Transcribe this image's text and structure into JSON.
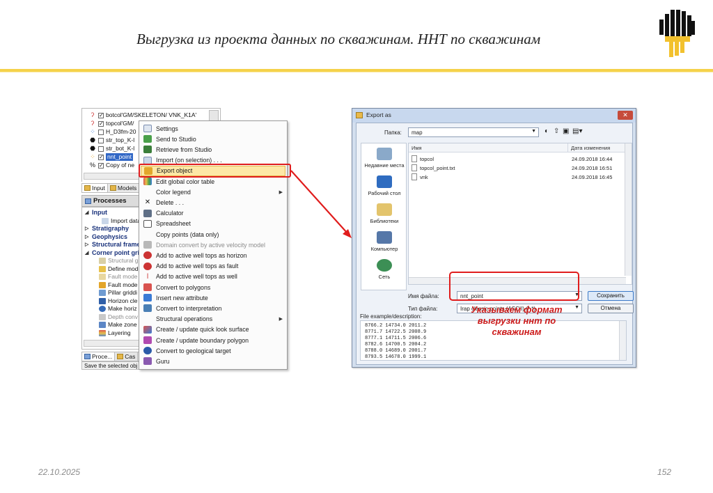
{
  "slide": {
    "title": "Выгрузка из проекта данных по скважинам. ННТ по скважинам",
    "date": "22.10.2025",
    "page": "152",
    "gold": "#f5d24a"
  },
  "tree": {
    "rows": [
      {
        "name": "botcol'GM/SKELETON/ VNK_K1A'"
      },
      {
        "name": "topcol'GM/"
      },
      {
        "name": "H_D3fm-20"
      },
      {
        "name": "str_top_K-l"
      },
      {
        "name": "str_bot_K-l"
      },
      {
        "name": "nnt_point"
      },
      {
        "name": "Copy of ne"
      }
    ],
    "tabs": [
      "Input",
      "Models"
    ]
  },
  "processes": {
    "header": "Processes",
    "items": [
      {
        "label": "Input",
        "type": "cat"
      },
      {
        "label": "Import data",
        "type": "item"
      },
      {
        "label": "Stratigraphy",
        "type": "cat"
      },
      {
        "label": "Geophysics",
        "type": "cat"
      },
      {
        "label": "Structural frame",
        "type": "cat"
      },
      {
        "label": "Corner point gri",
        "type": "cat"
      },
      {
        "label": "Structural g",
        "type": "dis"
      },
      {
        "label": "Define mod",
        "type": "item"
      },
      {
        "label": "Fault mode",
        "type": "dis"
      },
      {
        "label": "Fault mode",
        "type": "item"
      },
      {
        "label": "Pillar griddi",
        "type": "item"
      },
      {
        "label": "Horizon cle",
        "type": "item"
      },
      {
        "label": "Make horiz",
        "type": "item"
      },
      {
        "label": "Depth conv",
        "type": "dis"
      },
      {
        "label": "Make zone",
        "type": "item"
      },
      {
        "label": "Layering",
        "type": "item"
      }
    ],
    "bottom_tabs": [
      "Proce...",
      "Cas"
    ],
    "status": "Save the selected obj"
  },
  "context_menu": {
    "items": [
      {
        "label": "Settings",
        "disabled": false
      },
      {
        "label": "Send to Studio",
        "disabled": false
      },
      {
        "label": "Retrieve from Studio",
        "disabled": false
      },
      {
        "label": "Import (on selection) . . .",
        "disabled": false
      },
      {
        "label": "Export object",
        "disabled": false,
        "selected": true
      },
      {
        "label": "Edit global color table",
        "disabled": false
      },
      {
        "label": "Color legend",
        "disabled": false,
        "submenu": true
      },
      {
        "label": "Delete . . .",
        "disabled": false
      },
      {
        "label": "Calculator",
        "disabled": false
      },
      {
        "label": "Spreadsheet",
        "disabled": false
      },
      {
        "label": "Copy points (data only)",
        "disabled": false
      },
      {
        "label": "Domain convert by active velocity model",
        "disabled": true
      },
      {
        "label": "Add to active well tops as horizon",
        "disabled": false
      },
      {
        "label": "Add to active well tops as fault",
        "disabled": false
      },
      {
        "label": "Add to active well tops as well",
        "disabled": false
      },
      {
        "label": "Convert to polygons",
        "disabled": false
      },
      {
        "label": "Insert new attribute",
        "disabled": false
      },
      {
        "label": "Convert to interpretation",
        "disabled": false
      },
      {
        "label": "Structural operations",
        "disabled": false,
        "submenu": true
      },
      {
        "label": "Create / update quick look surface",
        "disabled": false
      },
      {
        "label": "Create / update boundary polygon",
        "disabled": false
      },
      {
        "label": "Convert to geological target",
        "disabled": false
      },
      {
        "label": "Guru",
        "disabled": false
      }
    ]
  },
  "dialog": {
    "title": "Export as",
    "folder_label": "Папка:",
    "folder_value": "map",
    "nav": [
      "Недавние места",
      "Рабочий стол",
      "Библиотеки",
      "Компьютер",
      "Сеть"
    ],
    "columns": {
      "name": "Имя",
      "date": "Дата изменения"
    },
    "files": [
      {
        "name": "topcol",
        "date": "24.09.2018 16:44"
      },
      {
        "name": "topcol_point.txt",
        "date": "24.09.2018 16:51"
      },
      {
        "name": "vnk",
        "date": "24.09.2018 16:45"
      }
    ],
    "filename_label": "Имя файла:",
    "filename_value": "nnt_point",
    "filetype_label": "Тип файла:",
    "filetype_value": "Irap classic points (ASCII) (*.*)",
    "save_button": "Сохранить",
    "cancel_button": "Отмена",
    "example_label": "File example/description:",
    "example_lines": [
      "8766.2  14734.0  2011.2",
      "8771.7  14722.5  2008.9",
      "8777.1  14711.5  2006.6",
      "8782.6  14700.5  2004.2",
      "8788.0  14689.0  2001.7",
      "8793.5  14678.0  1999.1"
    ]
  },
  "annotation": {
    "line1": "Указываем формат",
    "line2": "выгрузки ннт по",
    "line3": "скважинам",
    "color": "#cc1a1a"
  }
}
